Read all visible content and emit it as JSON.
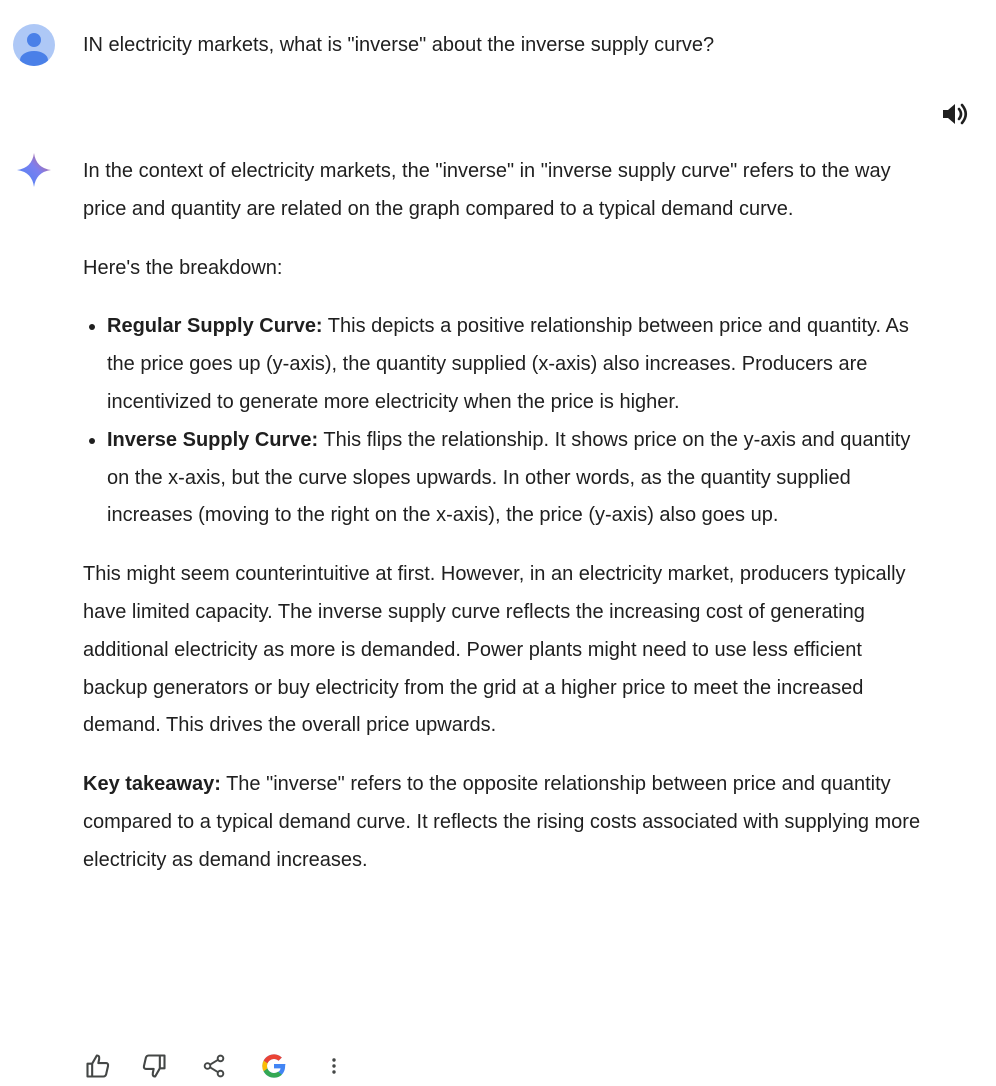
{
  "user": {
    "query": "IN electricity markets, what is \"inverse\" about the inverse supply curve?"
  },
  "response": {
    "intro": "In the context of electricity markets, the \"inverse\" in \"inverse supply curve\" refers to the way price and quantity are related on the graph compared to a typical demand curve.",
    "breakdown_intro": "Here's the breakdown:",
    "bullets": [
      {
        "title": "Regular Supply Curve:",
        "text": " This depicts a positive relationship between price and quantity. As the price goes up (y-axis), the quantity supplied (x-axis) also increases. Producers are incentivized to generate more electricity when the price is higher."
      },
      {
        "title": "Inverse Supply Curve:",
        "text": " This flips the relationship. It shows price on the y-axis and quantity on the x-axis, but the curve slopes upwards. In other words, as the quantity supplied increases (moving to the right on the x-axis), the price (y-axis) also goes up."
      }
    ],
    "explanation": "This might seem counterintuitive at first. However, in an electricity market, producers typically have limited capacity.  The inverse supply curve reflects the increasing cost of generating additional electricity as more is demanded. Power plants might need to use less efficient backup generators or buy electricity from the grid at a higher price to meet the increased demand. This drives the overall price upwards.",
    "takeaway_label": "Key takeaway:",
    "takeaway_text": " The \"inverse\" refers to the opposite relationship between price and quantity compared to a typical demand curve. It reflects the rising costs associated with supplying more electricity as demand increases."
  },
  "icons": {
    "avatar": "avatar-person-icon",
    "speaker": "volume-up-icon",
    "assistant": "gemini-sparkle-icon",
    "actions": [
      "thumbs-up-icon",
      "thumbs-down-icon",
      "share-icon",
      "google-icon",
      "more-vert-icon"
    ]
  },
  "colors": {
    "avatar_bg": "#aec8f6",
    "avatar_figure": "#4a80e8",
    "text": "#1f1f1f",
    "icon": "#444746"
  }
}
